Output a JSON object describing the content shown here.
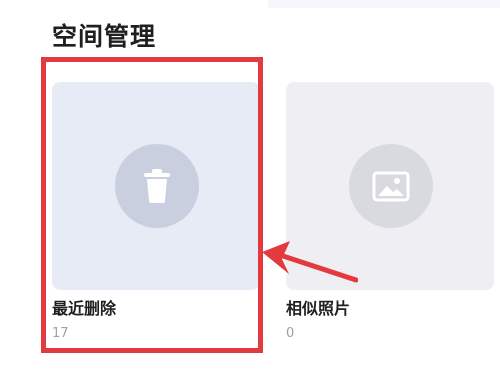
{
  "page": {
    "title": "空间管理"
  },
  "cards": [
    {
      "label": "最近删除",
      "count": "17",
      "icon": "trash-icon"
    },
    {
      "label": "相似照片",
      "count": "0",
      "icon": "image-icon"
    }
  ],
  "annotation": {
    "highlight_color": "#e23a3f",
    "arrow_color": "#e23a3f"
  }
}
